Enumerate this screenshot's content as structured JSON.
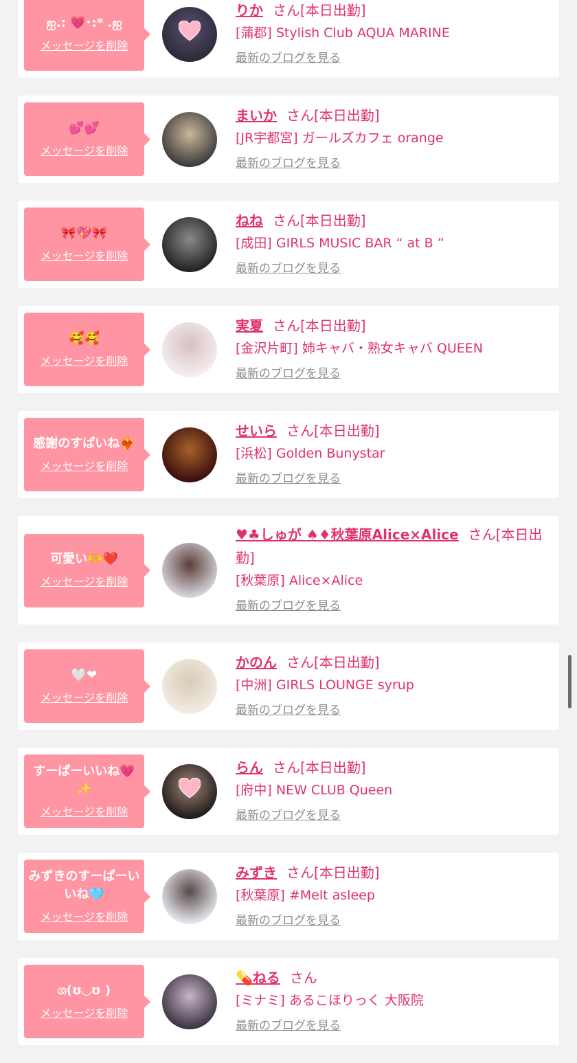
{
  "delete_label": "メッセージを削除",
  "san_label": "さん",
  "blog_label": "最新のブログを見る",
  "colors": {
    "accent": "#e0336a",
    "bubble": "#ff95a3",
    "link_gray": "#8d8d8d",
    "page_bg": "#f2f2f2"
  },
  "items": [
    {
      "message": "ஐ.: 💗･:* .ஐ",
      "name": "りか",
      "status": "[本日出勤]",
      "shop": "[蒲郡] Stylish Club AQUA MARINE",
      "avatar_colors": [
        "#2a2a38",
        "#5a4f6e"
      ],
      "avatar_heart": true
    },
    {
      "message": "💕💕",
      "name": "まいか",
      "status": "[本日出勤]",
      "shop": "[JR宇都宮] ガールズカフェ orange",
      "avatar_colors": [
        "#3d3a3a",
        "#c9b79a"
      ],
      "avatar_heart": false
    },
    {
      "message": "🎀💖🎀",
      "name": "ねね",
      "status": "[本日出勤]",
      "shop": "[成田] GIRLS MUSIC BAR “ at B ”",
      "avatar_colors": [
        "#222222",
        "#8a8a8a"
      ],
      "avatar_heart": false
    },
    {
      "message": "🥰🥰",
      "name": "実夏",
      "status": "[本日出勤]",
      "shop": "[金沢片町] 姉キャバ・熟女キャバ QUEEN",
      "avatar_colors": [
        "#f4efef",
        "#d7c0c0"
      ],
      "avatar_heart": false
    },
    {
      "message": "感謝のすぱいね❤️‍🔥",
      "name": "せいら",
      "status": "[本日出勤]",
      "shop": "[浜松] Golden Bunystar",
      "avatar_colors": [
        "#3a0d0d",
        "#a6622a"
      ],
      "avatar_heart": false
    },
    {
      "message": "可愛い🫶❤️",
      "name": "♥♣しゅが ♠♦秋葉原Alice×Alice",
      "status": "[本日出勤]",
      "shop": "[秋葉原] Alice×Alice",
      "avatar_colors": [
        "#d9d6de",
        "#5b3f38"
      ],
      "avatar_heart": false
    },
    {
      "message": "🤍❤",
      "name": "かのん",
      "status": "[本日出勤]",
      "shop": "[中洲] GIRLS LOUNGE syrup",
      "avatar_colors": [
        "#f2ece3",
        "#d8cbb7"
      ],
      "avatar_heart": false
    },
    {
      "message": "すーぱーいいね💗✨",
      "name": "らん",
      "status": "[本日出勤]",
      "shop": "[府中] NEW CLUB Queen",
      "avatar_colors": [
        "#1f1a1a",
        "#a08576"
      ],
      "avatar_heart": true
    },
    {
      "message": "みずきのすーぱーいいね🩵",
      "name": "みずき",
      "status": "[本日出勤]",
      "shop": "[秋葉原] #Melt asleep",
      "avatar_colors": [
        "#e6e8ee",
        "#5a4a4a"
      ],
      "avatar_heart": false
    },
    {
      "message": "ශ(ʊ◡ʊ )",
      "name": "💊ねる",
      "status": "",
      "shop": "[ミナミ] あるこほりっく 大阪院",
      "avatar_colors": [
        "#3a3340",
        "#c9b3c8"
      ],
      "avatar_heart": false
    }
  ]
}
